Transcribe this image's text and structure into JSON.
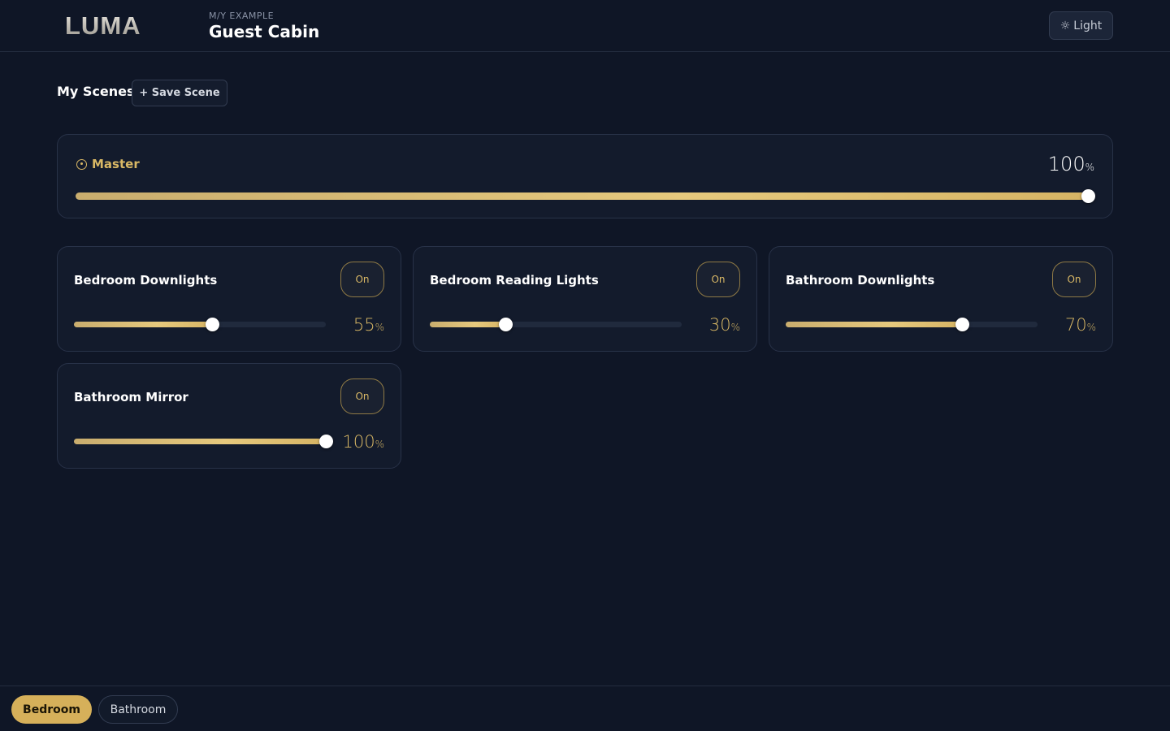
{
  "header": {
    "logo_text": "LUMA",
    "vessel": "M/Y EXAMPLE",
    "cabin": "Guest Cabin",
    "theme_button": "Light"
  },
  "scenes": {
    "title": "My Scenes",
    "save_label": "+ Save Scene"
  },
  "master": {
    "label": "Master",
    "value": 100,
    "value_text": "100",
    "unit": "%"
  },
  "lights": [
    {
      "name": "Bedroom Downlights",
      "state": "On",
      "value": 55,
      "value_text": "55",
      "unit": "%"
    },
    {
      "name": "Bedroom Reading Lights",
      "state": "On",
      "value": 30,
      "value_text": "30",
      "unit": "%"
    },
    {
      "name": "Bathroom Downlights",
      "state": "On",
      "value": 70,
      "value_text": "70",
      "unit": "%"
    },
    {
      "name": "Bathroom Mirror",
      "state": "On",
      "value": 100,
      "value_text": "100",
      "unit": "%"
    }
  ],
  "rooms": {
    "active": "Bedroom",
    "other": "Bathroom"
  },
  "colors": {
    "accent": "#d6b05a",
    "background": "#0f1626",
    "card": "#131b2c"
  }
}
